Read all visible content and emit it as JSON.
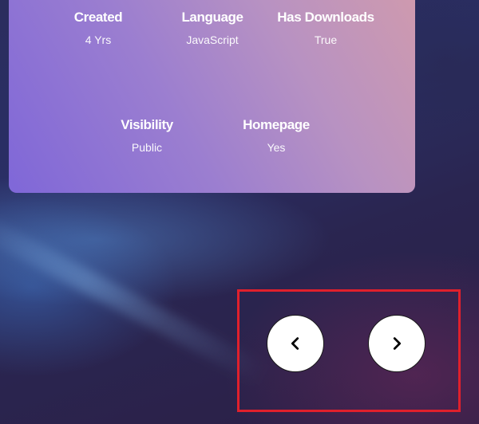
{
  "stats_card": {
    "items": [
      {
        "label": "Created",
        "value": "4 Yrs"
      },
      {
        "label": "Language",
        "value": "JavaScript"
      },
      {
        "label": "Has Downloads",
        "value": "True"
      },
      {
        "label": "Visibility",
        "value": "Public"
      },
      {
        "label": "Homepage",
        "value": "Yes"
      }
    ]
  },
  "navigation": {
    "prev_icon": "chevron-left-icon",
    "next_icon": "chevron-right-icon"
  },
  "colors": {
    "highlight_border": "#e0202c",
    "card_gradient_start": "#7f67d8",
    "card_gradient_end": "#cf9aae",
    "button_fill": "#ffffff"
  }
}
